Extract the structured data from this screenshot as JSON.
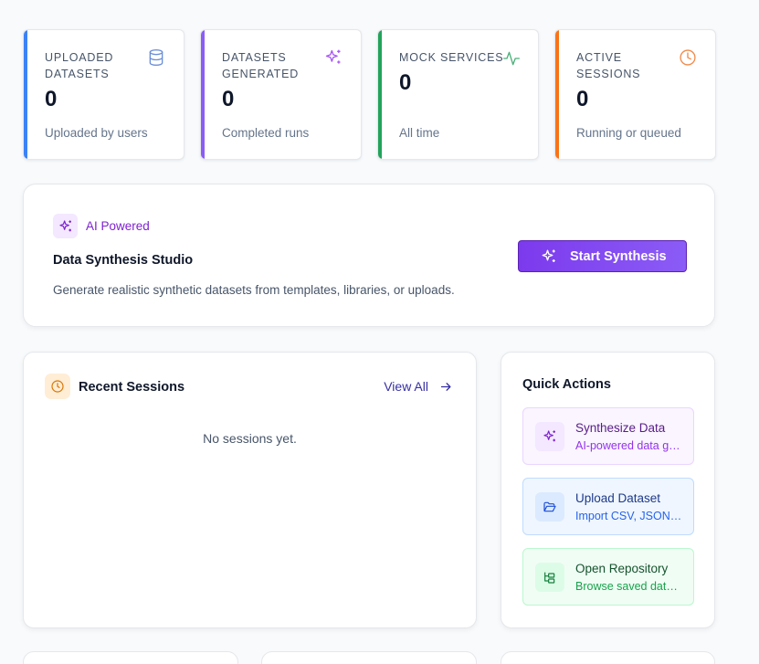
{
  "stats": [
    {
      "label": "Uploaded Datasets",
      "value": "0",
      "sub": "Uploaded by users",
      "icon": "database-icon",
      "accent": "#3b82f6"
    },
    {
      "label": "Datasets Generated",
      "value": "0",
      "sub": "Completed runs",
      "icon": "sparkles-icon",
      "accent": "#8b5cf6"
    },
    {
      "label": "Mock Services",
      "value": "0",
      "sub": "All time",
      "icon": "activity-icon",
      "accent": "#22a35a"
    },
    {
      "label": "Active Sessions",
      "value": "0",
      "sub": "Running or queued",
      "icon": "clock-icon",
      "accent": "#f97316"
    }
  ],
  "hero": {
    "badge": "AI Powered",
    "title": "Data Synthesis Studio",
    "description": "Generate realistic synthetic datasets from templates, libraries, or uploads.",
    "button_label": "Start Synthesis"
  },
  "sessions": {
    "title": "Recent Sessions",
    "view_all": "View All",
    "empty": "No sessions yet."
  },
  "quick_actions": {
    "title": "Quick Actions",
    "items": [
      {
        "title": "Synthesize Data",
        "sub": "AI-powered data generation",
        "icon": "sparkles-icon"
      },
      {
        "title": "Upload Dataset",
        "sub": "Import CSV, JSON, Excel",
        "icon": "folder-open-icon"
      },
      {
        "title": "Open Repository",
        "sub": "Browse saved datasets",
        "icon": "tree-icon"
      }
    ]
  },
  "colors": {
    "blue": "#3b82f6",
    "purple": "#8b5cf6",
    "green": "#22a35a",
    "orange": "#f97316"
  }
}
